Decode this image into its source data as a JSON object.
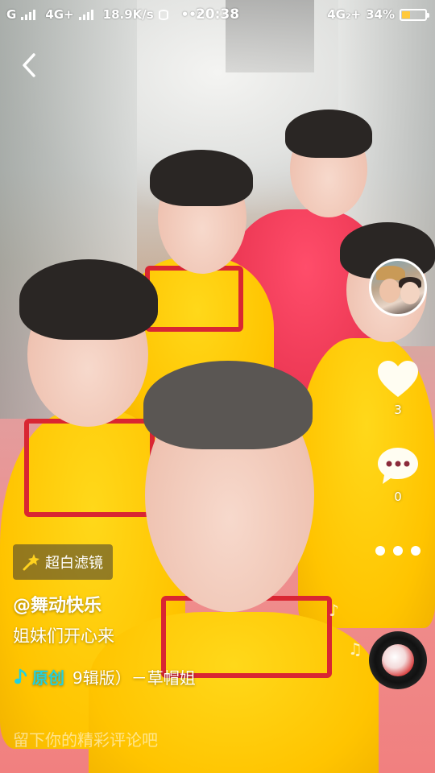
{
  "status_bar": {
    "carrier1": "G",
    "carrier2": "4G+",
    "net_speed": "18.9K/s",
    "overflow": "•••",
    "time": "20:38",
    "carrier_right": "4G₂+",
    "battery_percent": "34%",
    "battery_level": 0.34,
    "battery_color": "#ffc93c"
  },
  "nav": {
    "back_icon": "chevron-left-icon"
  },
  "actions": {
    "like_count": "3",
    "comment_count": "0",
    "avatar_icon": "creator-avatar",
    "like_icon": "heart-icon",
    "comment_icon": "speech-bubble-icon",
    "more_icon": "more-dots-icon"
  },
  "video_info": {
    "filter_label": "超白滤镜",
    "filter_icon": "magic-wand-icon",
    "username": "@舞动快乐",
    "caption": "姐妹们开心来",
    "music_tag": "原创",
    "music_title": "9辑版）－草帽姐",
    "music_icon": "music-note-icon",
    "accent_color": "#21d1e0"
  },
  "comment": {
    "placeholder": "留下你的精彩评论吧"
  }
}
